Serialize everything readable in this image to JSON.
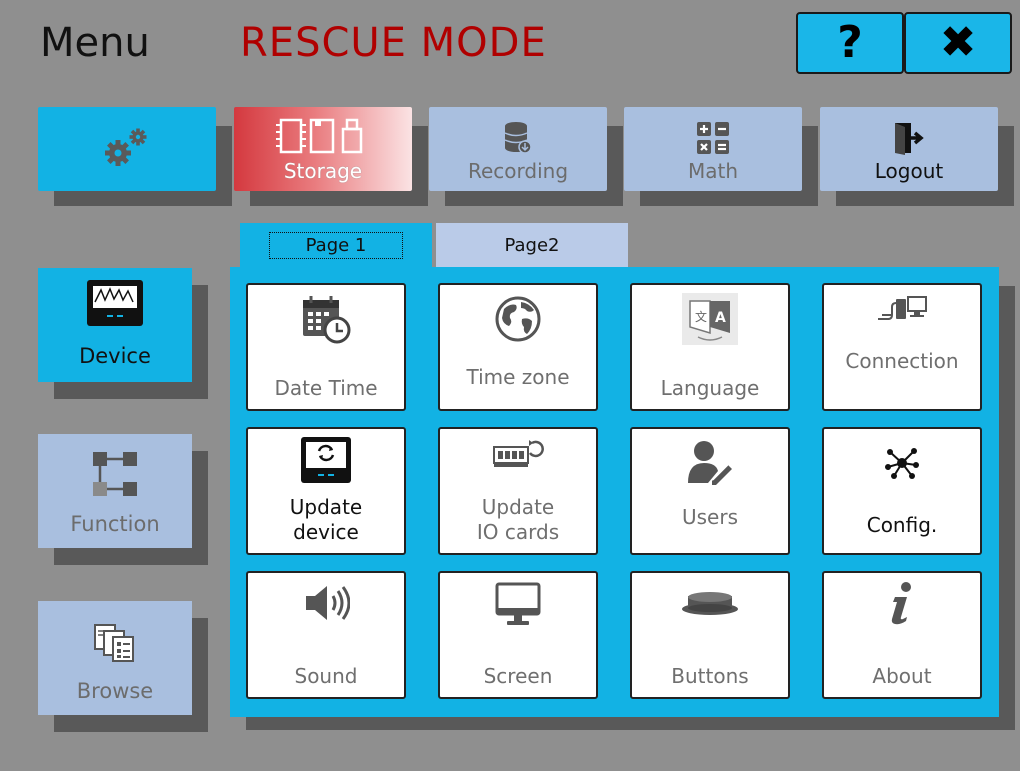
{
  "header": {
    "menu_label": "Menu",
    "mode_label": "RESCUE MODE",
    "help_label": "?",
    "close_label": "✖"
  },
  "top_nav": {
    "settings_icon": "gears-icon",
    "storage_label": "Storage",
    "recording_label": "Recording",
    "math_label": "Math",
    "logout_label": "Logout"
  },
  "side_nav": {
    "device_label": "Device",
    "function_label": "Function",
    "browse_label": "Browse"
  },
  "tabs": {
    "page1": "Page 1",
    "page2": "Page2"
  },
  "tiles": {
    "date_time": "Date Time",
    "time_zone": "Time zone",
    "language": "Language",
    "connection": "Connection",
    "update_device_1": "Update",
    "update_device_2": "device",
    "update_io_1": "Update",
    "update_io_2": "IO cards",
    "users": "Users",
    "config": "Config.",
    "sound": "Sound",
    "screen": "Screen",
    "buttons": "Buttons",
    "about": "About"
  },
  "colors": {
    "accent": "#12b2e4",
    "background": "#8f8f8f",
    "rescue": "#b00000",
    "tile_light": "#a9bfdf"
  }
}
